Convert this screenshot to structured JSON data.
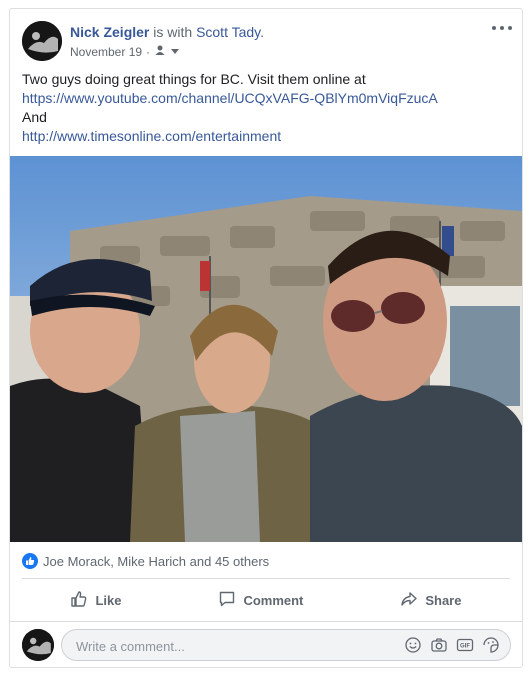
{
  "post": {
    "author": "Nick Zeigler",
    "with_text": " is with ",
    "tagged": "Scott Tady",
    "tagged_suffix": ".",
    "date": "November 19",
    "text_line1": "Two guys doing great things for BC. Visit them online at",
    "link1": "https://www.youtube.com/channel/UCQxVAFG-QBlYm0mViqFzucA",
    "text_line2": "And",
    "link2": "http://www.timesonline.com/entertainment"
  },
  "reactions": {
    "summary": "Joe Morack, Mike Harich and 45 others"
  },
  "actions": {
    "like": "Like",
    "comment": "Comment",
    "share": "Share"
  },
  "comment_box": {
    "placeholder": "Write a comment..."
  },
  "colors": {
    "link": "#385898",
    "like_blue": "#1877f2",
    "meta_gray": "#606770"
  },
  "icons": [
    "audience-friends-icon",
    "dropdown-caret-icon",
    "more-options-icon",
    "like-thumb-icon",
    "comment-bubble-icon",
    "share-arrow-icon",
    "emoji-icon",
    "camera-icon",
    "gif-icon",
    "sticker-icon"
  ]
}
